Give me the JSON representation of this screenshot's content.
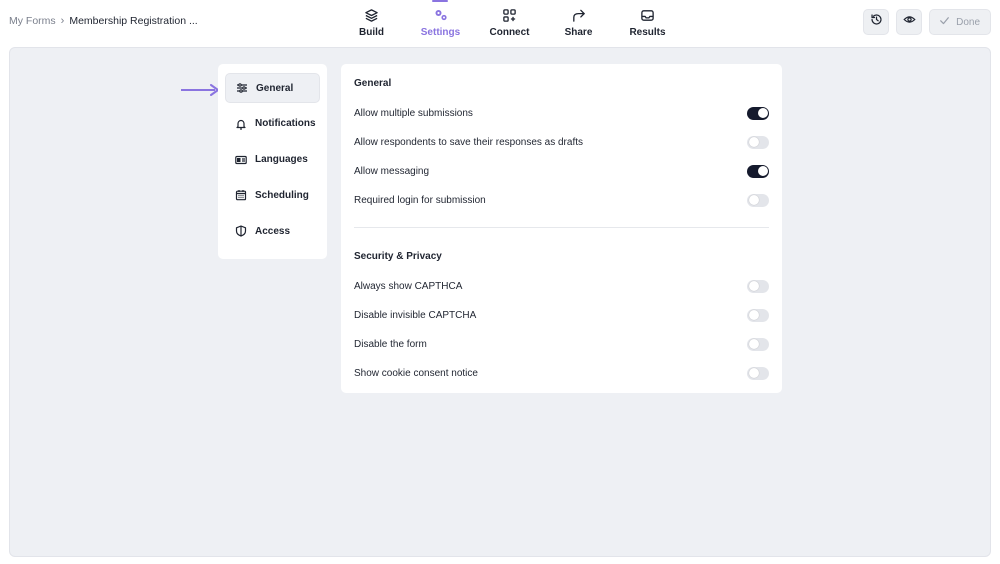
{
  "breadcrumb": {
    "root": "My Forms",
    "separator": "›",
    "current": "Membership Registration ..."
  },
  "nav": {
    "tabs": [
      {
        "label": "Build",
        "icon": "layers-icon"
      },
      {
        "label": "Settings",
        "icon": "gears-icon"
      },
      {
        "label": "Connect",
        "icon": "apps-plus-icon"
      },
      {
        "label": "Share",
        "icon": "share-arrow-icon"
      },
      {
        "label": "Results",
        "icon": "inbox-icon"
      }
    ],
    "active": "Settings"
  },
  "actions": {
    "history_icon": "history-icon",
    "preview_icon": "eye-icon",
    "done_label": "Done"
  },
  "sidebar": {
    "items": [
      {
        "label": "General",
        "icon": "sliders-icon"
      },
      {
        "label": "Notifications",
        "icon": "bell-icon"
      },
      {
        "label": "Languages",
        "icon": "language-icon"
      },
      {
        "label": "Scheduling",
        "icon": "calendar-icon"
      },
      {
        "label": "Access",
        "icon": "shield-icon"
      }
    ],
    "active": "General"
  },
  "general": {
    "title": "General",
    "settings": [
      {
        "label": "Allow multiple submissions",
        "enabled": true
      },
      {
        "label": "Allow respondents to save their responses as drafts",
        "enabled": false
      },
      {
        "label": "Allow messaging",
        "enabled": true
      },
      {
        "label": "Required login for submission",
        "enabled": false
      }
    ]
  },
  "security": {
    "title": "Security & Privacy",
    "settings": [
      {
        "label": "Always show CAPTHCA",
        "enabled": false
      },
      {
        "label": "Disable invisible CAPTCHA",
        "enabled": false
      },
      {
        "label": "Disable the form",
        "enabled": false
      },
      {
        "label": "Show cookie consent notice",
        "enabled": false
      }
    ]
  },
  "colors": {
    "accent": "#8a74e0",
    "toggle_on": "#151a2d",
    "toggle_off": "#e3e5ea",
    "canvas": "#eef0f4"
  }
}
